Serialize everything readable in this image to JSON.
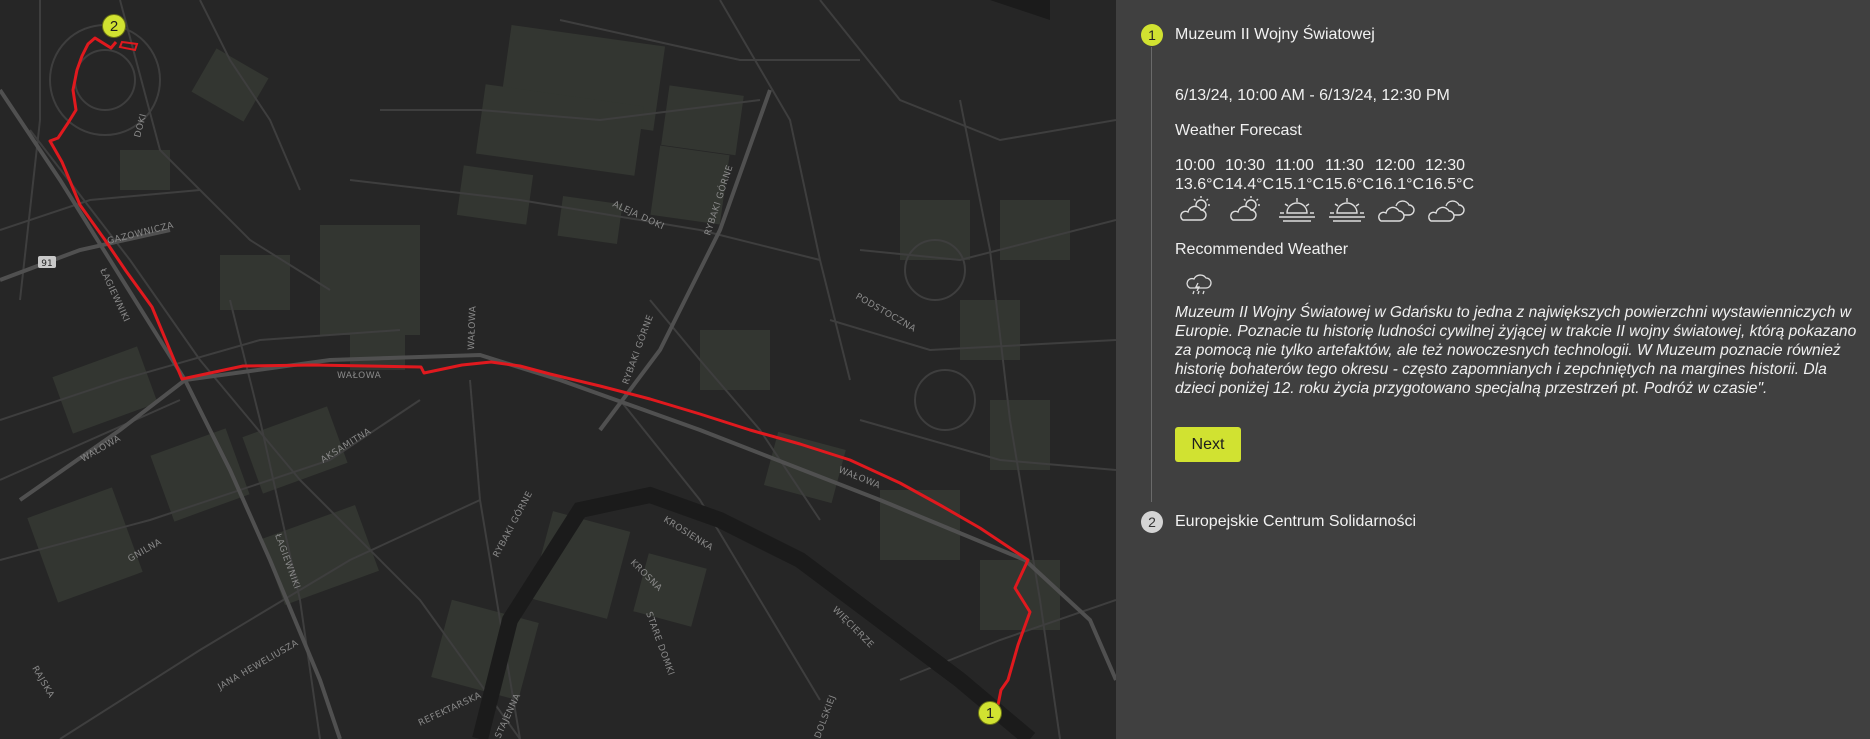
{
  "map": {
    "street_labels": [
      "DOKI",
      "GAZOWNICZA",
      "ŁAGIEWNIKI",
      "WAŁOWA",
      "ALEJA DOKI",
      "RYBAKI GÓRNE",
      "PODSTOCZNA",
      "AKSAMITNA",
      "GNILNA",
      "JANA HEWELIUSZA",
      "RAJSKA",
      "REFEKTARSKA",
      "STAJENNA",
      "KROSIENKA",
      "KROSNA",
      "STARE DOMKI",
      "WIĘCIERZE",
      "DOLSKIEJ"
    ],
    "road_badge": "91",
    "markers": [
      {
        "label": "2"
      },
      {
        "label": "1"
      }
    ],
    "route_color": "#e0191e"
  },
  "panel": {
    "steps": [
      {
        "number": "1",
        "title": "Muzeum II Wojny Światowej"
      },
      {
        "number": "2",
        "title": "Europejskie Centrum Solidarności"
      }
    ],
    "time_range": "6/13/24, 10:00 AM - 6/13/24, 12:30 PM",
    "weather_heading": "Weather Forecast",
    "forecast": [
      {
        "time": "10:00",
        "temp": "13.6°C",
        "icon": "partly-cloudy-icon"
      },
      {
        "time": "10:30",
        "temp": "14.4°C",
        "icon": "partly-cloudy-icon"
      },
      {
        "time": "11:00",
        "temp": "15.1°C",
        "icon": "sunrise-icon"
      },
      {
        "time": "11:30",
        "temp": "15.6°C",
        "icon": "sunrise-icon"
      },
      {
        "time": "12:00",
        "temp": "16.1°C",
        "icon": "cloudy-icon"
      },
      {
        "time": "12:30",
        "temp": "16.5°C",
        "icon": "cloudy-icon"
      }
    ],
    "recommended_heading": "Recommended Weather",
    "recommended_icon": "rain-cloud-icon",
    "description": "Muzeum II Wojny Światowej w Gdańsku to jedna z największych powierzchni wystawienniczych w Europie. Poznacie tu historię ludności cywilnej żyjącej w trakcie II wojny światowej, którą pokazano za pomocą nie tylko artefaktów, ale też nowoczesnych technologii. W Muzeum poznacie również historię bohaterów tego okresu - często zapomnianych i zepchniętych na margines historii. Dla dzieci poniżej 12. roku życia przygotowano specjalną przestrzeń pt. Podróż w czasie\".",
    "next_label": "Next",
    "accent_color": "#d1e231"
  }
}
